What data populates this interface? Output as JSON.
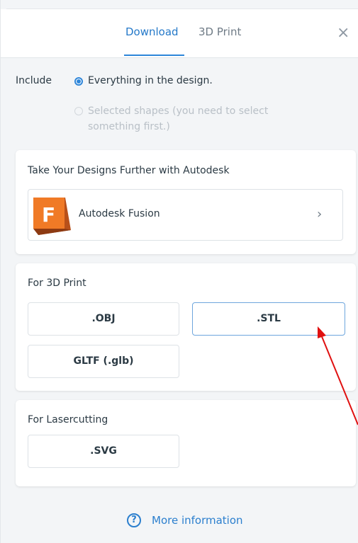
{
  "tabs": {
    "download": "Download",
    "print3d": "3D Print",
    "close_symbol": "×"
  },
  "include": {
    "label": "Include",
    "option_everything": "Everything in the design.",
    "option_selected": "Selected shapes (you need to select something first.)"
  },
  "autodesk": {
    "title": "Take Your Designs Further with Autodesk",
    "product_name": "Autodesk Fusion",
    "logo_letter": "F",
    "chevron": "›"
  },
  "print3d": {
    "title": "For 3D Print",
    "obj": ".OBJ",
    "stl": ".STL",
    "glb": "GLTF (.glb)"
  },
  "laser": {
    "title": "For Lasercutting",
    "svg": ".SVG"
  },
  "footer": {
    "more_info": "More information",
    "help_symbol": "?"
  },
  "colors": {
    "accent": "#2b7fce",
    "fusion_orange": "#f07a26",
    "annotation_arrow": "#e01010"
  }
}
